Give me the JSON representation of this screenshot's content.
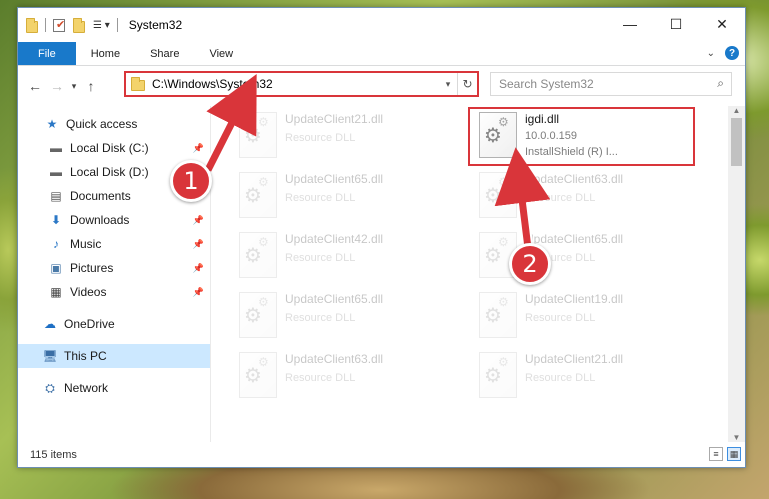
{
  "window": {
    "title": "System32",
    "minimize_glyph": "—",
    "maximize_glyph": "☐",
    "close_glyph": "✕"
  },
  "ribbon": {
    "tabs": [
      "File",
      "Home",
      "Share",
      "View"
    ]
  },
  "address": {
    "path": "C:\\Windows\\System32",
    "search_placeholder": "Search System32"
  },
  "nav": {
    "items": [
      {
        "label": "Quick access",
        "icon": "star-icon"
      },
      {
        "label": "Local Disk (C:)",
        "icon": "drive-icon",
        "pinned": true
      },
      {
        "label": "Local Disk (D:)",
        "icon": "drive-icon"
      },
      {
        "label": "Documents",
        "icon": "document-icon"
      },
      {
        "label": "Downloads",
        "icon": "download-icon",
        "pinned": true
      },
      {
        "label": "Music",
        "icon": "music-icon",
        "pinned": true
      },
      {
        "label": "Pictures",
        "icon": "pictures-icon",
        "pinned": true
      },
      {
        "label": "Videos",
        "icon": "videos-icon",
        "pinned": true
      },
      {
        "label": "OneDrive",
        "icon": "cloud-icon"
      },
      {
        "label": "This PC",
        "icon": "computer-icon",
        "selected": true
      },
      {
        "label": "Network",
        "icon": "network-icon"
      }
    ]
  },
  "files": {
    "left_column": [
      {
        "name": "UpdateClient21.dll",
        "desc": "Resource DLL"
      },
      {
        "name": "UpdateClient65.dll",
        "desc": "Resource DLL"
      },
      {
        "name": "UpdateClient42.dll",
        "desc": "Resource DLL"
      },
      {
        "name": "UpdateClient65.dll",
        "desc": "Resource DLL"
      },
      {
        "name": "UpdateClient63.dll",
        "desc": "Resource DLL"
      }
    ],
    "right_column": [
      {
        "name": "igdi.dll",
        "desc": "10.0.0.159",
        "desc2": "InstallShield (R) I...",
        "highlight": true
      },
      {
        "name": "UpdateClient63.dll",
        "desc": "Resource DLL"
      },
      {
        "name": "UpdateClient65.dll",
        "desc": "Resource DLL"
      },
      {
        "name": "UpdateClient19.dll",
        "desc": "Resource DLL"
      },
      {
        "name": "UpdateClient21.dll",
        "desc": "Resource DLL"
      }
    ]
  },
  "status": {
    "item_count": "115 items"
  },
  "callouts": {
    "step1": "1",
    "step2": "2"
  },
  "colors": {
    "accent": "#1979ca",
    "highlight": "#d9353a",
    "selection": "#cce8ff"
  }
}
